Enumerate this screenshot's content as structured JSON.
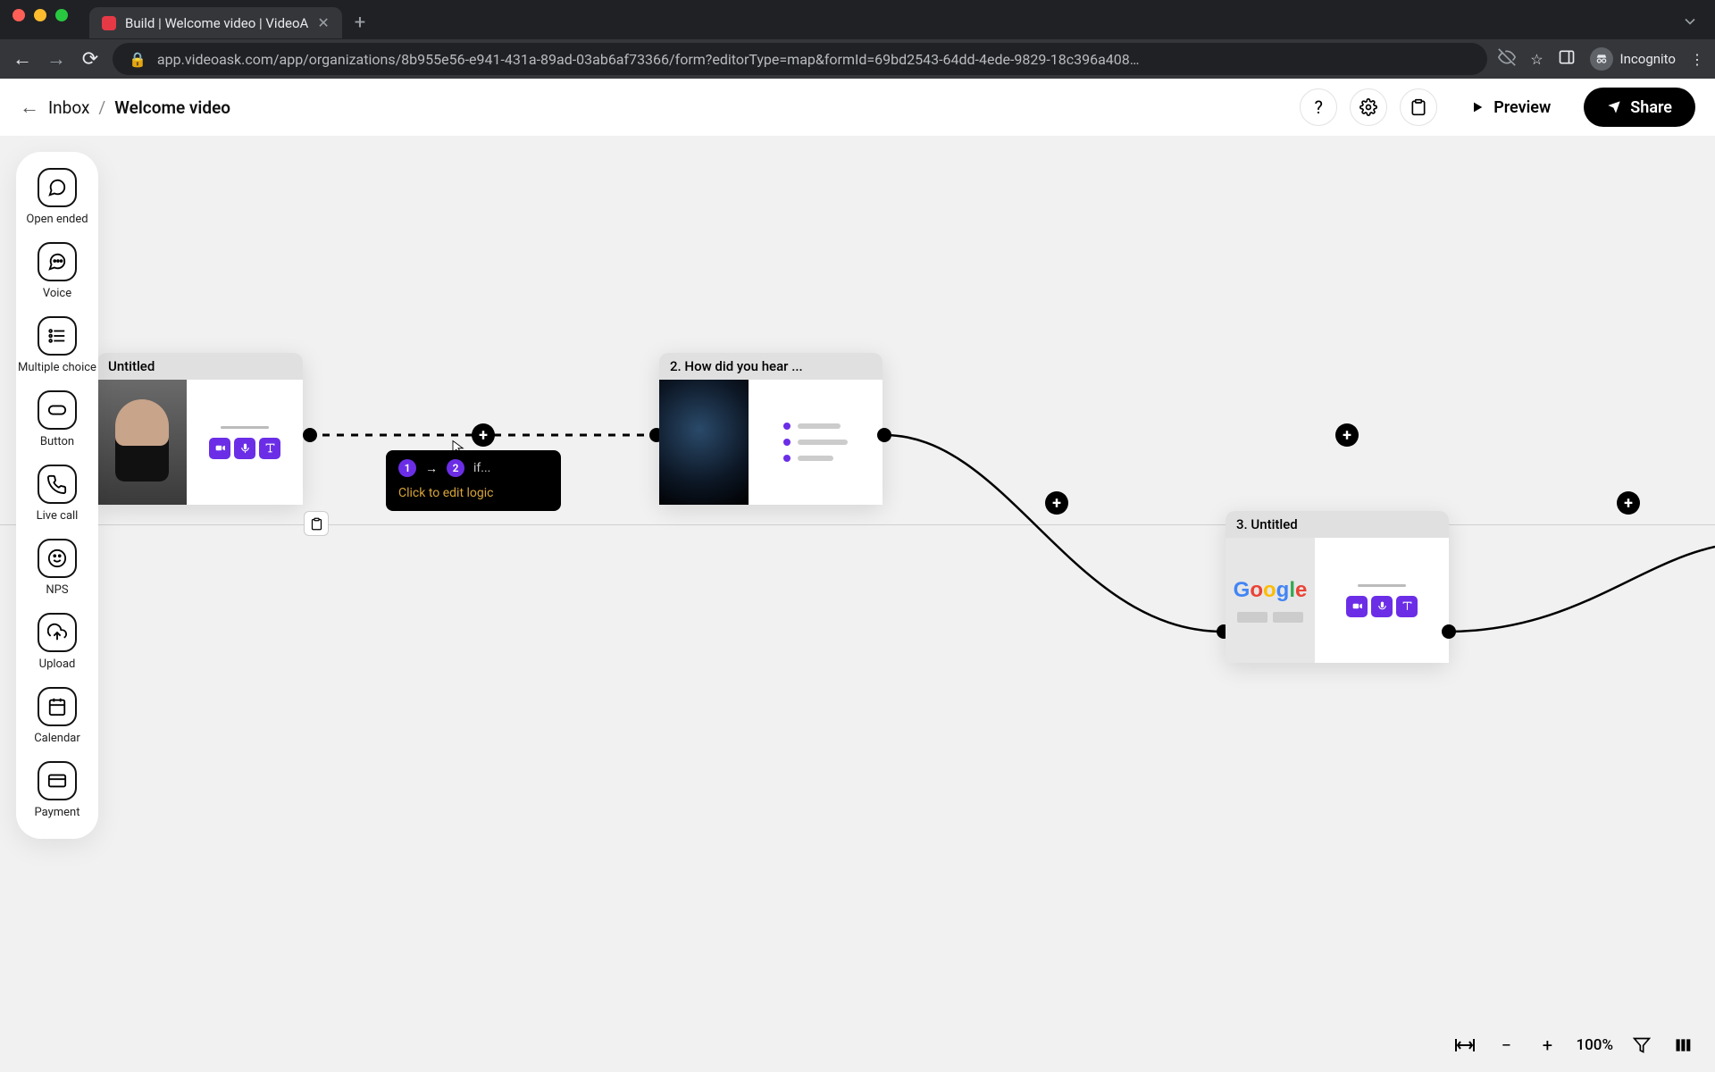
{
  "browser": {
    "tab_title": "Build | Welcome video | VideoA",
    "new_tab_plus": "+",
    "url": "app.videoask.com/app/organizations/8b955e56-e941-431a-89ad-03ab6af73366/form?editorType=map&formId=69bd2543-64dd-4ede-9829-18c396a408…",
    "incognito_label": "Incognito"
  },
  "appbar": {
    "back_arrow": "←",
    "inbox_label": "Inbox",
    "separator": "/",
    "page_title": "Welcome video",
    "help": "?",
    "preview": "Preview",
    "share": "Share"
  },
  "tools": [
    {
      "id": "open-ended",
      "label": "Open ended"
    },
    {
      "id": "voice",
      "label": "Voice"
    },
    {
      "id": "multiple-choice",
      "label": "Multiple choice"
    },
    {
      "id": "button",
      "label": "Button"
    },
    {
      "id": "live-call",
      "label": "Live call"
    },
    {
      "id": "nps",
      "label": "NPS"
    },
    {
      "id": "upload",
      "label": "Upload"
    },
    {
      "id": "calendar",
      "label": "Calendar"
    },
    {
      "id": "payment",
      "label": "Payment"
    }
  ],
  "steps": {
    "s1": {
      "title": "Untitled"
    },
    "s2": {
      "title": "2. How did you hear ..."
    },
    "s3": {
      "title": "3. Untitled"
    }
  },
  "logic_tip": {
    "from": "1",
    "to": "2",
    "cond": "if...",
    "hint": "Click to edit logic"
  },
  "footer": {
    "zoom": "100%"
  }
}
